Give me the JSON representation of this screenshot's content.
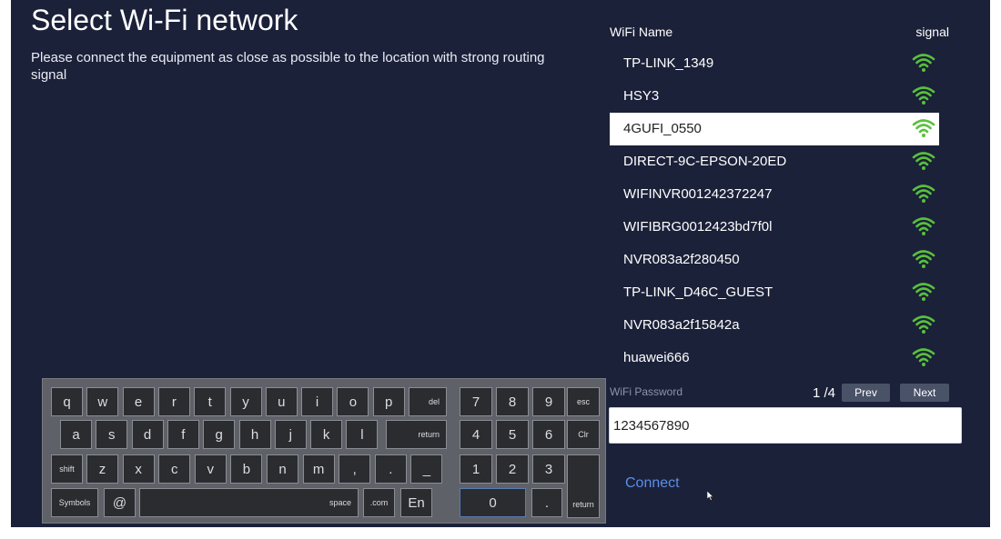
{
  "page": {
    "title": "Select Wi-Fi network",
    "subtitle": "Please connect the equipment as close as possible to the location with strong routing signal"
  },
  "wifi": {
    "header_name": "WiFi Name",
    "header_signal": "signal",
    "signal_color": "#58c13b",
    "selected_index": 2,
    "networks": [
      {
        "name": "TP-LINK_1349",
        "icon": "wifi-signal-icon"
      },
      {
        "name": "HSY3",
        "icon": "wifi-signal-icon"
      },
      {
        "name": "4GUFI_0550",
        "icon": "wifi-signal-icon"
      },
      {
        "name": "DIRECT-9C-EPSON-20ED",
        "icon": "wifi-signal-icon"
      },
      {
        "name": "WIFINVR001242372247",
        "icon": "wifi-signal-icon"
      },
      {
        "name": "WIFIBRG0012423bd7f0l",
        "icon": "wifi-signal-icon"
      },
      {
        "name": "NVR083a2f280450",
        "icon": "wifi-signal-icon"
      },
      {
        "name": "TP-LINK_D46C_GUEST",
        "icon": "wifi-signal-icon"
      },
      {
        "name": "NVR083a2f15842a",
        "icon": "wifi-signal-icon"
      },
      {
        "name": "huawei666",
        "icon": "wifi-signal-icon"
      }
    ]
  },
  "password": {
    "label": "WiFi Password",
    "value": "1234567890"
  },
  "pager": {
    "text": "1 /4",
    "prev_label": "Prev",
    "next_label": "Next"
  },
  "connect_label": "Connect",
  "keyboard": {
    "row1": [
      "q",
      "w",
      "e",
      "r",
      "t",
      "y",
      "u",
      "i",
      "o",
      "p"
    ],
    "row2": [
      "a",
      "s",
      "d",
      "f",
      "g",
      "h",
      "j",
      "k",
      "l"
    ],
    "row3": [
      "z",
      "x",
      "c",
      "v",
      "b",
      "n",
      "m",
      ",",
      ".",
      "_"
    ],
    "del": "del",
    "return": "return",
    "shift": "shift",
    "symbols": "Symbols",
    "at": "@",
    "space": "space",
    "com": ".com",
    "lang": "En",
    "num_rows": [
      [
        "7",
        "8",
        "9"
      ],
      [
        "4",
        "5",
        "6"
      ],
      [
        "1",
        "2",
        "3"
      ]
    ],
    "esc": "esc",
    "clr": "Clr",
    "zero": "0",
    "dot": ".",
    "num_return": "return"
  }
}
